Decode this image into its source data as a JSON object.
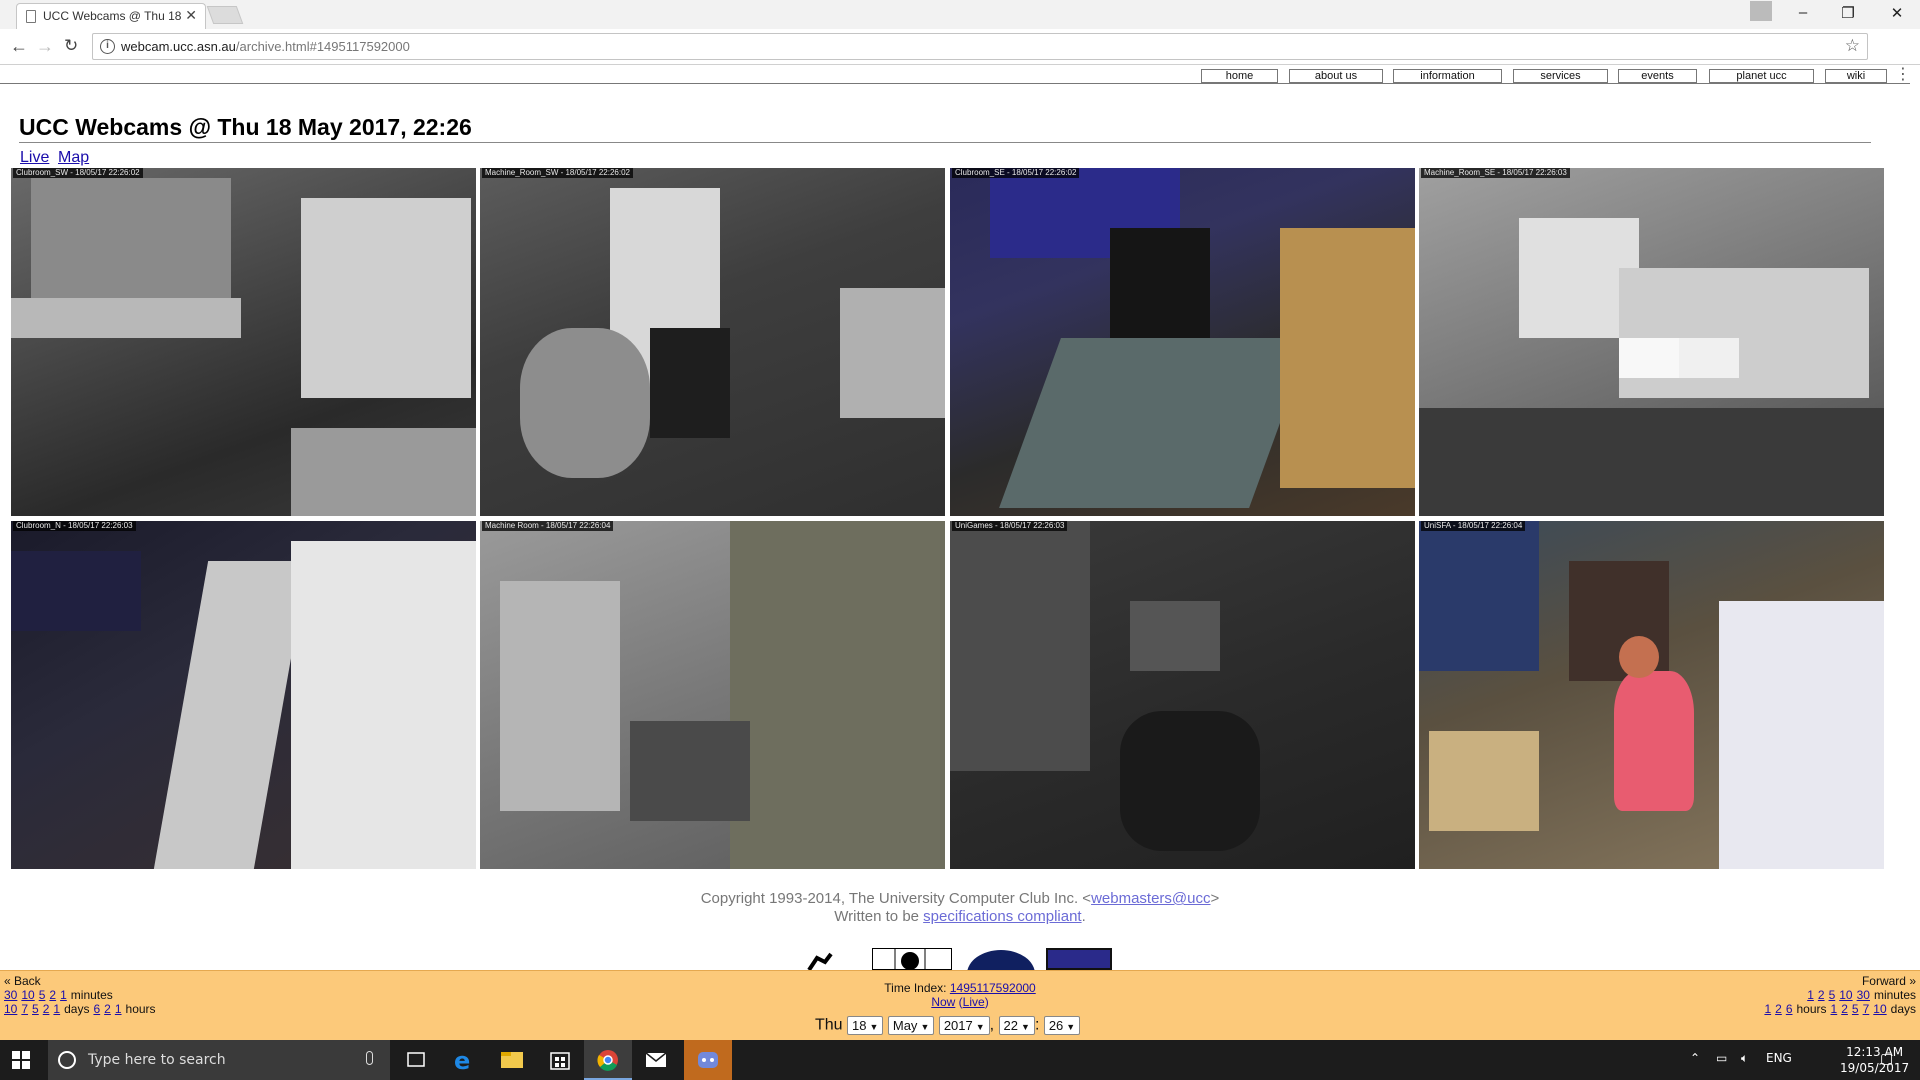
{
  "browser": {
    "tab_title": "UCC Webcams @ Thu 18",
    "url_host": "webcam.ucc.asn.au",
    "url_path": "/archive.html#1495117592000"
  },
  "nav": [
    "home",
    "about us",
    "information",
    "services",
    "events",
    "planet ucc",
    "wiki"
  ],
  "page": {
    "title": "UCC Webcams @ Thu 18 May 2017, 22:26",
    "live_link": "Live",
    "map_link": "Map"
  },
  "cams": [
    {
      "label": "Clubroom_SW - 18/05/17 22:26:02"
    },
    {
      "label": "Machine_Room_SW - 18/05/17 22:26:02"
    },
    {
      "label": "Clubroom_SE - 18/05/17 22:26:02"
    },
    {
      "label": "Machine_Room_SE - 18/05/17 22:26:03"
    },
    {
      "label": "Clubroom_N - 18/05/17 22:26:03"
    },
    {
      "label": "Machine Room - 18/05/17 22:26:04"
    },
    {
      "label": "UniGames - 18/05/17 22:26:03"
    },
    {
      "label": "UniSFA - 18/05/17 22:26:04"
    }
  ],
  "footer": {
    "copyright": "Copyright 1993-2014, The University Computer Club Inc. <",
    "email": "webmasters@ucc",
    "copyright_end": ">",
    "written": "Written to be ",
    "spec_link": "specifications compliant",
    "period": "."
  },
  "timebar": {
    "back_label": "« Back",
    "back_minutes": [
      "30",
      "10",
      "5",
      "2",
      "1"
    ],
    "minutes_label": "minutes",
    "back_days": [
      "10",
      "7",
      "5",
      "2",
      "1"
    ],
    "days_label": "days",
    "back_hours": [
      "6",
      "2",
      "1"
    ],
    "hours_label": "hours",
    "index_label": "Time Index:",
    "index_value": "1495117592000",
    "now_link": "Now",
    "live_link": "Live",
    "forward_label": "Forward »",
    "fwd_minutes": [
      "1",
      "2",
      "5",
      "10",
      "30"
    ],
    "fwd_hours": [
      "1",
      "2",
      "6"
    ],
    "fwd_days": [
      "1",
      "2",
      "5",
      "7",
      "10"
    ],
    "day_name": "Thu",
    "day": "18",
    "month": "May",
    "year": "2017",
    "hour": "22",
    "minute": "26"
  },
  "taskbar": {
    "search_placeholder": "Type here to search",
    "lang": "ENG",
    "time": "12:13 AM",
    "date": "19/05/2017"
  },
  "colors": {
    "timebar_bg": "#fcc97a",
    "link": "#1a0dab",
    "footer_link": "#6b6bd6"
  }
}
